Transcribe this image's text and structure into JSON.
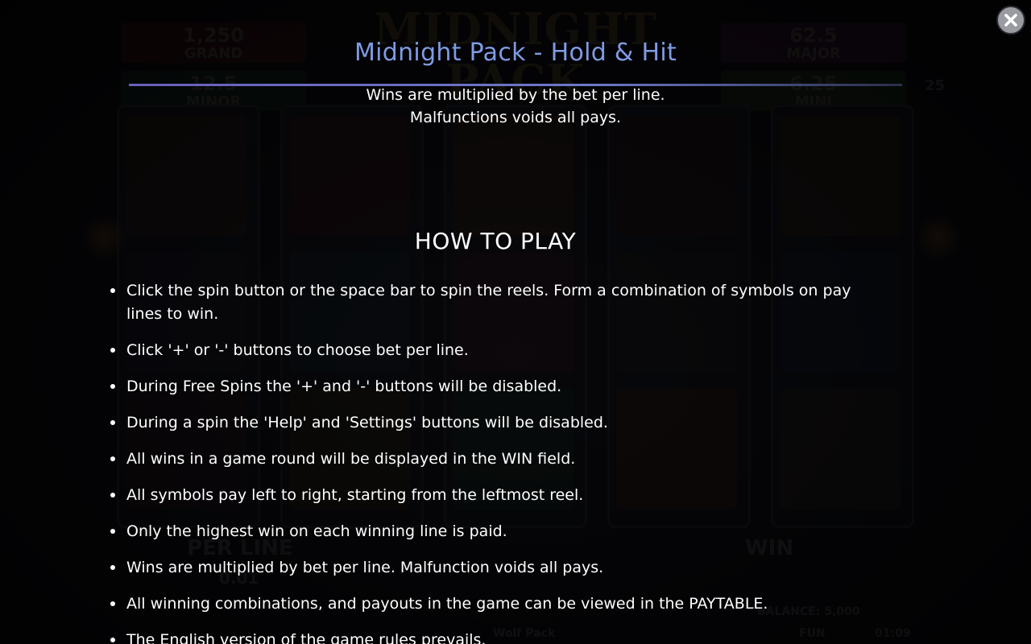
{
  "background": {
    "logo_text": "MIDNIGHT PACK",
    "jackpots": [
      {
        "amount": "1,250",
        "label": "GRAND"
      },
      {
        "amount": "62.5",
        "label": "MAJOR"
      },
      {
        "amount": "12.5",
        "label": "MINOR"
      },
      {
        "amount": "6.25",
        "label": "MINI"
      }
    ],
    "per_line_label": "PER LINE",
    "per_line_value": "0.01",
    "win_label": "WIN",
    "balance_text": "BALANCE: 5,000",
    "mode_text": "FUN",
    "clock_text": "01:09",
    "game_name_footer": "Wolf Pack",
    "lines_count": "25"
  },
  "modal": {
    "title": "Midnight Pack - Hold & Hit",
    "intro_lines": [
      "Wins are multiplied by the bet per line.",
      "Malfunctions voids all pays."
    ],
    "section_heading": "HOW TO PLAY",
    "rules": [
      "Click the spin button or the space bar  to spin the reels. Form a combination of symbols on pay lines to win.",
      "Click '+' or '-' buttons to choose bet per line.",
      "During Free Spins the '+' and '-' buttons will be disabled.",
      "During a spin the 'Help' and 'Settings' buttons will be disabled.",
      "All wins in a game round will be displayed in the WIN field.",
      "All symbols pay left to right, starting from the leftmost reel.",
      "Only the highest win on each winning line is paid.",
      "Wins are multiplied by bet per line. Malfunction voids all pays.",
      "All winning combinations, and payouts in the game can be viewed in the PAYTABLE.",
      "The English version of the game rules prevails."
    ]
  },
  "close_icon": "close-icon",
  "colors": {
    "title": "#7f9be3",
    "rule_line": "#6a5fb8",
    "text": "#ffffff",
    "overlay": "#000000"
  }
}
